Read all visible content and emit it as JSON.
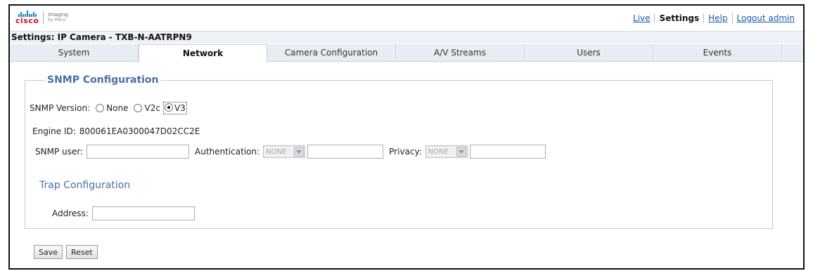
{
  "header": {
    "brand": "cisco",
    "sub_brand_line1": "Imaging",
    "sub_brand_line2": "by Pelco",
    "links": {
      "live": "Live",
      "settings": "Settings",
      "help": "Help",
      "logout": "Logout admin"
    }
  },
  "page_title": "Settings: IP Camera - TXB-N-AATRPN9",
  "tabs": [
    {
      "label": "System"
    },
    {
      "label": "Network"
    },
    {
      "label": "Camera Configuration"
    },
    {
      "label": "A/V Streams"
    },
    {
      "label": "Users"
    },
    {
      "label": "Events"
    }
  ],
  "snmp": {
    "legend": "SNMP Configuration",
    "version_label": "SNMP Version:",
    "version_options": {
      "none": "None",
      "v2c": "V2c",
      "v3": "V3"
    },
    "selected_version": "V3",
    "engine_id_label": "Engine ID:",
    "engine_id_value": "800061EA0300047D02CC2E",
    "user_label": "SNMP user:",
    "user_value": "",
    "auth_label": "Authentication:",
    "auth_select": "NONE",
    "auth_value": "",
    "privacy_label": "Privacy:",
    "privacy_select": "NONE",
    "privacy_value": ""
  },
  "trap": {
    "heading": "Trap Configuration",
    "address_label": "Address:",
    "address_value": ""
  },
  "buttons": {
    "save": "Save",
    "reset": "Reset"
  }
}
